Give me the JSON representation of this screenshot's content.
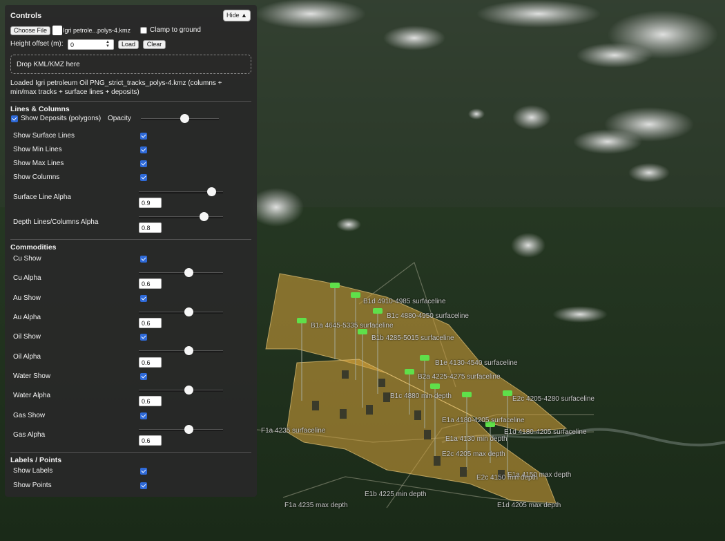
{
  "controls": {
    "title": "Controls",
    "hide_label": "Hide ▲",
    "choose_file_label": "Choose File",
    "file_name": "Igri petrole...polys-4.kmz",
    "clamp_label": "Clamp to ground",
    "clamp_checked": false,
    "height_offset_label": "Height offset (m):",
    "height_offset_value": "0",
    "load_label": "Load",
    "clear_label": "Clear",
    "drop_label": "Drop KML/KMZ here",
    "status": "Loaded Igri petroleum Oil PNG_strict_tracks_polys-4.kmz (columns + min/max tracks + surface lines + deposits)"
  },
  "lines_columns": {
    "header": "Lines & Columns",
    "show_deposits_label": "Show Deposits (polygons)",
    "opacity_label": "Opacity",
    "opacity_level": 0.66,
    "toggles": [
      {
        "label": "Show Surface Lines",
        "checked": true
      },
      {
        "label": "Show Min Lines",
        "checked": true
      },
      {
        "label": "Show Max Lines",
        "checked": true
      },
      {
        "label": "Show Columns",
        "checked": true
      }
    ],
    "surface_alpha_label": "Surface Line Alpha",
    "surface_alpha_value": "0.9",
    "depth_alpha_label": "Depth Lines/Columns Alpha",
    "depth_alpha_value": "0.8"
  },
  "commodities": {
    "header": "Commodities",
    "items": [
      {
        "show_label": "Cu Show",
        "alpha_label": "Cu Alpha",
        "alpha_value": "0.6"
      },
      {
        "show_label": "Au Show",
        "alpha_label": "Au Alpha",
        "alpha_value": "0.6"
      },
      {
        "show_label": "Oil Show",
        "alpha_label": "Oil Alpha",
        "alpha_value": "0.6"
      },
      {
        "show_label": "Water Show",
        "alpha_label": "Water Alpha",
        "alpha_value": "0.6"
      },
      {
        "show_label": "Gas Show",
        "alpha_label": "Gas Alpha",
        "alpha_value": "0.6"
      }
    ]
  },
  "labels_points": {
    "header": "Labels / Points",
    "show_labels_label": "Show Labels",
    "show_points_label": "Show Points"
  },
  "map": {
    "deposit_color": "#d9a43a",
    "marker_color": "#5fe04a",
    "labels": [
      "B1a 4645-5335 surfaceline",
      "B1b 4285-5015 surfaceline",
      "B1c 4880-4950 surfaceline",
      "B1d 4910-4985 surfaceline",
      "B1e 4130-4540 surfaceline",
      "B2a 4225-4275 surfaceline",
      "E1a 4180-4205 surfaceline",
      "E1d 4180-4205 surfaceline",
      "E2c 4205-4280 surfaceline",
      "E1a 4130 min depth",
      "E1a 4150 max depth",
      "E1b 4225 min depth",
      "F1a 4235 max depth",
      "E1d 4205 max depth",
      "F1a 4235 surfaceline",
      "E2c 4205 max depth",
      "E2c 4150 min depth",
      "B1c 4880 min depth"
    ]
  }
}
